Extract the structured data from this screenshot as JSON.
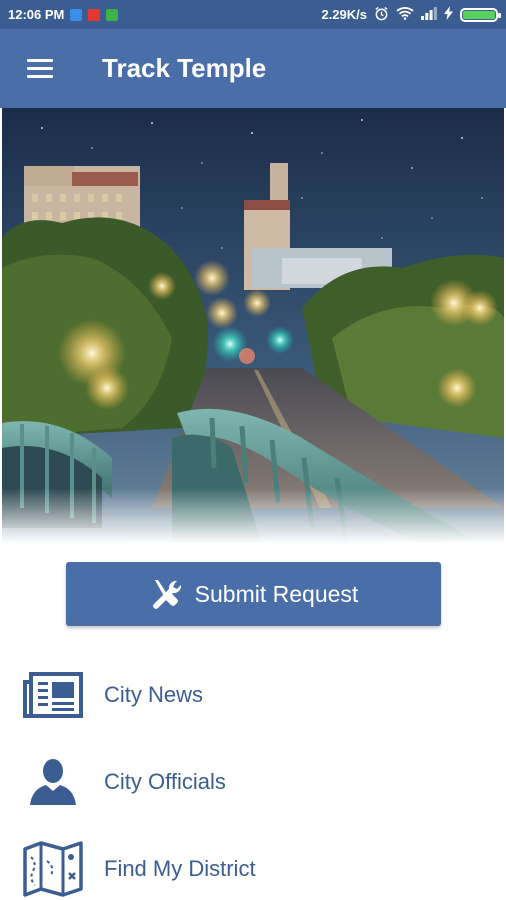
{
  "status_bar": {
    "time": "12:06 PM",
    "speed": "2.29K/s",
    "battery_level_percent": 100
  },
  "app_bar": {
    "title": "Track Temple",
    "menu_icon": "hamburger-menu-icon"
  },
  "hero": {
    "image_icon": "city-night-street-photo"
  },
  "submit_button": {
    "label": "Submit Request",
    "icon": "wrench-screwdriver-icon"
  },
  "nav": {
    "items": [
      {
        "label": "City News",
        "icon": "newspaper-icon"
      },
      {
        "label": "City Officials",
        "icon": "person-icon"
      },
      {
        "label": "Find My District",
        "icon": "map-icon"
      }
    ]
  },
  "colors": {
    "primary": "#4a6ea8",
    "status_bar": "#3c5d92",
    "text_link": "#3c5d92"
  }
}
